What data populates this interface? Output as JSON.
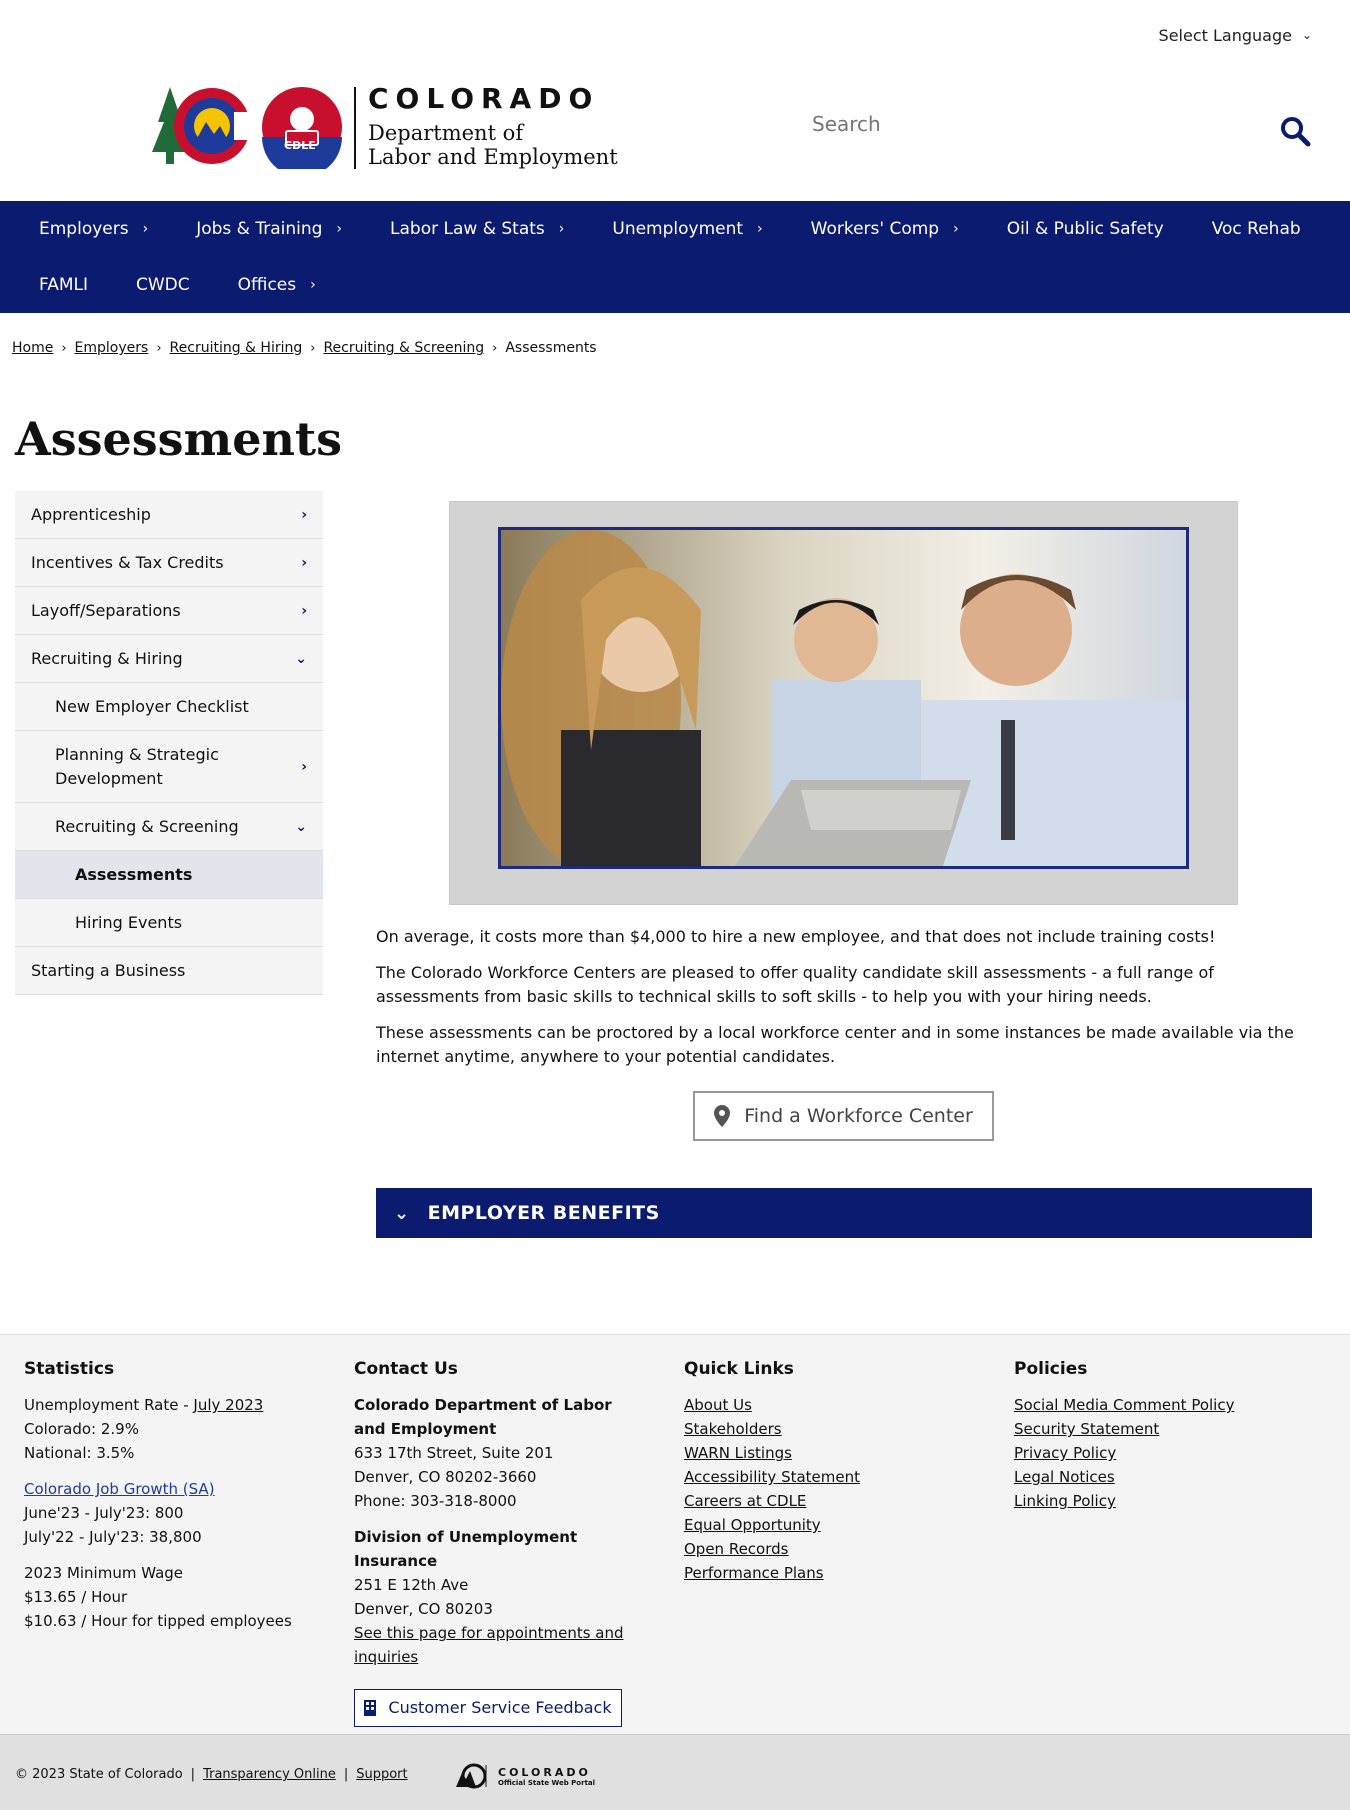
{
  "header": {
    "language_label": "Select Language",
    "logo_state": "COLORADO",
    "logo_dept_line1": "Department of",
    "logo_dept_line2": "Labor and Employment",
    "logo_badge": "CDLE",
    "search_placeholder": "Search"
  },
  "nav": {
    "items": [
      {
        "label": "Employers",
        "has_arrow": true
      },
      {
        "label": "Jobs & Training",
        "has_arrow": true
      },
      {
        "label": "Labor Law & Stats",
        "has_arrow": true
      },
      {
        "label": "Unemployment",
        "has_arrow": true
      },
      {
        "label": "Workers' Comp",
        "has_arrow": true
      },
      {
        "label": "Oil & Public Safety",
        "has_arrow": false
      },
      {
        "label": "Voc Rehab",
        "has_arrow": false
      },
      {
        "label": "FAMLI",
        "has_arrow": false
      },
      {
        "label": "CWDC",
        "has_arrow": false
      },
      {
        "label": "Offices",
        "has_arrow": true
      }
    ]
  },
  "breadcrumb": [
    "Home",
    "Employers",
    "Recruiting & Hiring",
    "Recruiting & Screening",
    "Assessments"
  ],
  "page_title": "Assessments",
  "sidebar": {
    "items": [
      "Apprenticeship",
      "Incentives & Tax Credits",
      "Layoff/Separations",
      "Recruiting & Hiring",
      "New Employer Checklist",
      "Planning & Strategic Development",
      "Recruiting & Screening",
      "Assessments",
      "Hiring Events",
      "Starting a Business"
    ]
  },
  "main": {
    "para1": "On average, it costs more than $4,000 to hire a new employee, and that does not include training costs!",
    "para2": "The Colorado Workforce Centers are pleased to offer quality candidate skill assessments - a full range of assessments from basic skills to technical skills to soft skills - to help you with your hiring needs.",
    "para3": "These assessments can be proctored by a local workforce center and in some instances be made available via the internet anytime, anywhere to your potential candidates.",
    "workforce_button": "Find a Workforce Center",
    "accordion_label": "EMPLOYER BENEFITS"
  },
  "footer": {
    "statistics": {
      "heading": "Statistics",
      "unemployment_prefix": "Unemployment Rate - ",
      "unemployment_link": "July 2023",
      "colorado_rate": "Colorado: 2.9%",
      "national_rate": "National: 3.5%",
      "job_growth_link": "Colorado Job Growth (SA)",
      "growth_1": "June'23 - July'23: 800",
      "growth_2": "July'22 - July'23: 38,800",
      "min_wage_heading": "2023 Minimum Wage",
      "min_wage_1": "$13.65 / Hour",
      "min_wage_2": "$10.63 / Hour for tipped employees"
    },
    "contact": {
      "heading": "Contact Us",
      "org1": "Colorado Department of Labor and Employment",
      "addr1": "633 17th Street, Suite 201",
      "city1": "Denver, CO  80202-3660",
      "phone1": "Phone: 303-318-8000",
      "org2": "Division of Unemployment Insurance",
      "addr2": "251 E 12th Ave",
      "city2": "Denver, CO  80203",
      "appt_link": "See this page for appointments and inquiries",
      "feedback_button": "Customer Service Feedback"
    },
    "quick_links": {
      "heading": "Quick Links",
      "links": [
        "About Us",
        "Stakeholders",
        "WARN Listings",
        "Accessibility Statement",
        "Careers at CDLE",
        "Equal Opportunity",
        "Open Records",
        "Performance Plans"
      ]
    },
    "policies": {
      "heading": "Policies",
      "links": [
        "Social Media Comment Policy",
        "Security Statement",
        "Privacy Policy",
        "Legal Notices",
        "Linking Policy"
      ]
    }
  },
  "bottom_bar": {
    "copyright": "© 2023 State of Colorado",
    "transparency": "Transparency Online",
    "support": "Support",
    "portal_name": "COLORADO",
    "portal_sub": "Official State Web Portal"
  },
  "colors": {
    "nav_bg": "#0b1b6f",
    "footer_bg": "#f4f4f4",
    "accent_red": "#c8102e",
    "logo_blue": "#1e3a9a"
  }
}
